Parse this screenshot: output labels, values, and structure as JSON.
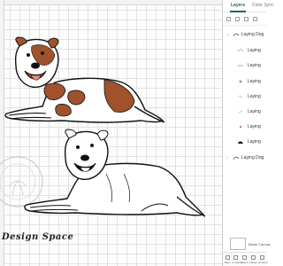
{
  "panel": {
    "tabs": [
      {
        "label": "Layers"
      },
      {
        "label": "Color Sync"
      }
    ],
    "layers": [
      {
        "label": "Laying Dog",
        "type": "group"
      },
      {
        "label": "Laying",
        "type": "layer"
      },
      {
        "label": "Laying",
        "type": "layer"
      },
      {
        "label": "Laying",
        "type": "layer"
      },
      {
        "label": "Laying",
        "type": "layer"
      },
      {
        "label": "Laying",
        "type": "layer"
      },
      {
        "label": "Laying",
        "type": "layer"
      },
      {
        "label": "Laying",
        "type": "layer"
      },
      {
        "label": "Laying Dog",
        "type": "group"
      }
    ],
    "blank_canvas_label": "Blank Canvas",
    "bottom_actions": [
      {
        "label": "Slice"
      },
      {
        "label": "Combine"
      },
      {
        "label": "Attach"
      },
      {
        "label": "Flatten"
      },
      {
        "label": "Contour"
      }
    ]
  },
  "watermark": {
    "text": "Design Space"
  },
  "colors": {
    "accent": "#1e6a50",
    "patch": "#a0522d",
    "grid": "#e2e2e2"
  }
}
